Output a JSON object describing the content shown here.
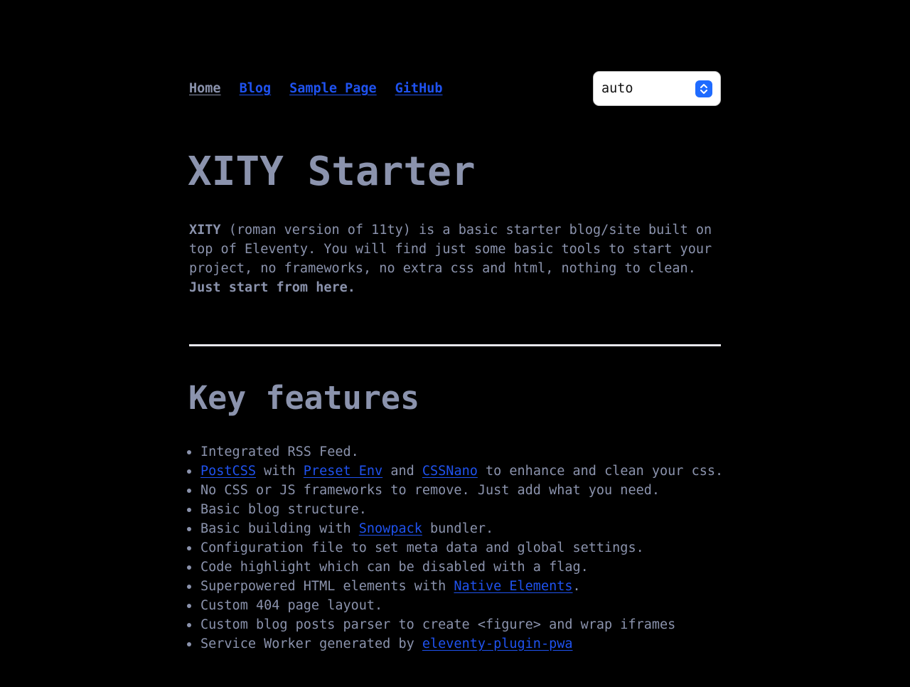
{
  "nav": {
    "items": [
      {
        "label": "Home"
      },
      {
        "label": "Blog"
      },
      {
        "label": "Sample Page"
      },
      {
        "label": "GitHub"
      }
    ]
  },
  "theme_select": {
    "value": "auto",
    "icon": "chevron-up-down-icon"
  },
  "hero": {
    "title": "XITY Starter",
    "intro": {
      "strong_name": "XITY",
      "text": " (roman version of 11ty) is a basic starter blog/site built on top of Eleventy. You will find just some basic tools to start your project, no frameworks, no extra css and html, nothing to clean. ",
      "strong_cta": "Just start from here."
    }
  },
  "features": {
    "heading": "Key features",
    "items": {
      "rss": "Integrated RSS Feed.",
      "postcss": {
        "link1": "PostCSS",
        "t1": " with ",
        "link2": "Preset Env",
        "t2": " and ",
        "link3": "CSSNano",
        "t3": " to enhance and clean your css."
      },
      "no_frameworks": "No CSS or JS frameworks to remove. Just add what you need.",
      "blog": "Basic blog structure.",
      "snowpack": {
        "t1": "Basic building with ",
        "link": "Snowpack",
        "t2": " bundler."
      },
      "config": "Configuration file to set meta data and global settings.",
      "highlight": "Code highlight which can be disabled with a flag.",
      "native": {
        "t1": "Superpowered HTML elements with ",
        "link": "Native Elements",
        "t2": "."
      },
      "page404": "Custom 404 page layout.",
      "parser": "Custom blog posts parser to create <figure> and wrap iframes",
      "sw": {
        "t1": "Service Worker generated by ",
        "link": "eleventy-plugin-pwa"
      }
    }
  },
  "colors": {
    "background": "#000000",
    "text": "#8b93ad",
    "link": "#1f52ef",
    "select_accent": "#1f6bff"
  }
}
